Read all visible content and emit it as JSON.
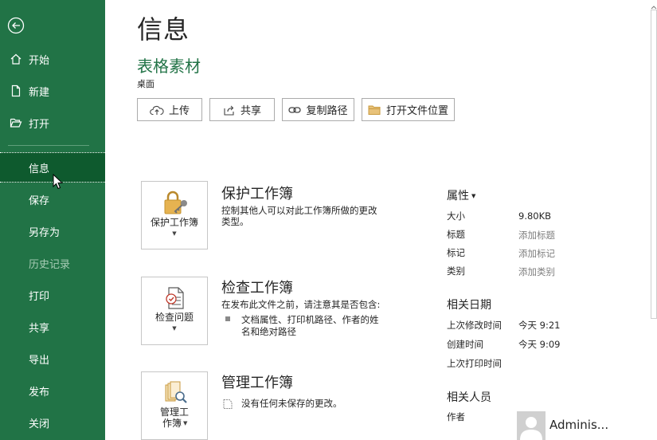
{
  "sidebar": {
    "items": [
      {
        "label": "开始"
      },
      {
        "label": "新建"
      },
      {
        "label": "打开"
      },
      {
        "label": "信息"
      },
      {
        "label": "保存"
      },
      {
        "label": "另存为"
      },
      {
        "label": "历史记录"
      },
      {
        "label": "打印"
      },
      {
        "label": "共享"
      },
      {
        "label": "导出"
      },
      {
        "label": "发布"
      },
      {
        "label": "关闭"
      }
    ],
    "active_index": 3,
    "disabled_index": 6,
    "bg_color": "#217346",
    "active_color": "#0e5a2e"
  },
  "header": {
    "title": "信息",
    "doc_name": "表格素材",
    "location": "桌面"
  },
  "actions": {
    "upload": "上传",
    "share": "共享",
    "copy_path": "复制路径",
    "open_location": "打开文件位置"
  },
  "sections": {
    "protect": {
      "button_label": "保护工作簿",
      "title": "保护工作簿",
      "desc_line1": "控制其他人可以对此工作簿所做的更改",
      "desc_line2": "类型。"
    },
    "inspect": {
      "button_label": "检查问题",
      "title": "检查工作簿",
      "desc": "在发布此文件之前，请注意其是否包含:",
      "bullet_line1": "文档属性、打印机路径、作者的姓",
      "bullet_line2": "名和绝对路径"
    },
    "manage": {
      "button_label_line1": "管理工",
      "button_label_line2": "作簿",
      "title": "管理工作簿",
      "desc": "没有任何未保存的更改。"
    }
  },
  "properties": {
    "heading": "属性",
    "rows": [
      {
        "label": "大小",
        "value": "9.80KB"
      },
      {
        "label": "标题",
        "value": "添加标题"
      },
      {
        "label": "标记",
        "value": "添加标记"
      },
      {
        "label": "类别",
        "value": "添加类别"
      }
    ]
  },
  "dates": {
    "heading": "相关日期",
    "rows": [
      {
        "label": "上次修改时间",
        "value": "今天 9:21"
      },
      {
        "label": "创建时间",
        "value": "今天 9:09"
      },
      {
        "label": "上次打印时间",
        "value": ""
      }
    ]
  },
  "people": {
    "heading": "相关人员",
    "author_label": "作者",
    "author_name": "Adminis..."
  },
  "icons": {
    "back": "back-arrow-icon",
    "home": "home-icon",
    "new": "new-document-icon",
    "open": "open-folder-icon",
    "upload": "cloud-upload-icon",
    "share": "share-icon",
    "link": "link-icon",
    "folder": "folder-icon",
    "lock": "lock-key-icon",
    "inspect": "inspect-document-icon",
    "manage": "manage-workbook-icon"
  },
  "accent_color": "#217346"
}
